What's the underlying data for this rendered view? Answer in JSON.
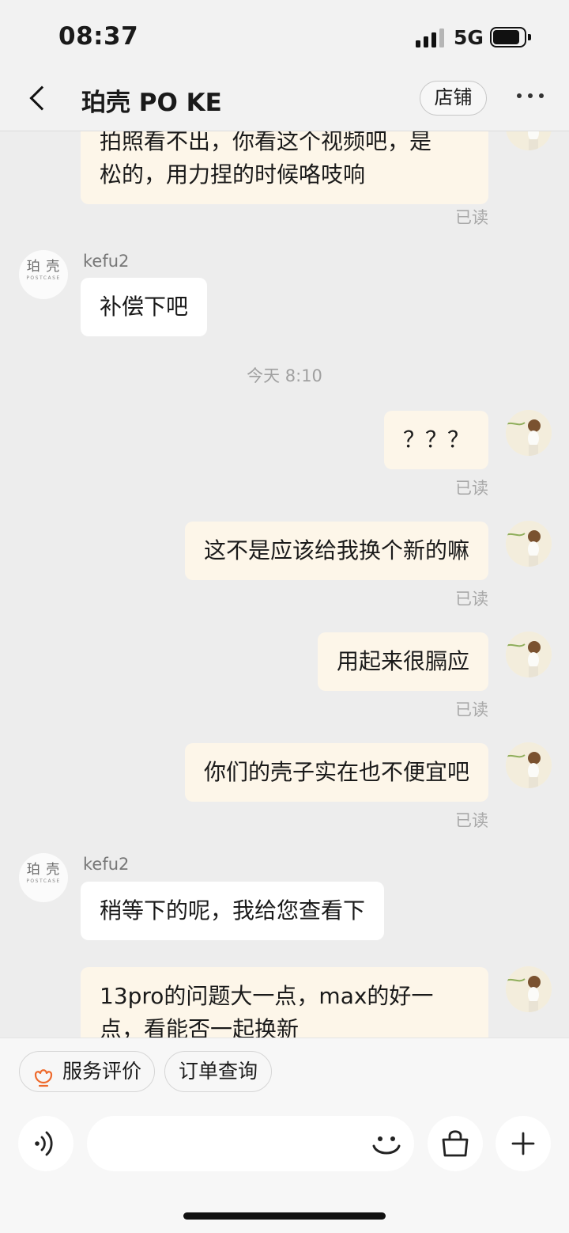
{
  "status_bar": {
    "time": "08:37",
    "network": "5G"
  },
  "header": {
    "title": "珀壳 PO KE",
    "store_label": "店铺"
  },
  "shop_avatar": {
    "logo_text": "珀 壳",
    "logo_sub": "POSTCASE"
  },
  "messages": [
    {
      "from": "me",
      "lines": [
        "拍照看不出，你看这个视频吧，是",
        "松的，用力捏的时候咯吱响"
      ],
      "status": "已读"
    },
    {
      "from": "shop",
      "sender": "kefu2",
      "text": "补偿下吧"
    },
    {
      "timestamp": "今天 8:10"
    },
    {
      "from": "me",
      "text": "？？？",
      "status": "已读"
    },
    {
      "from": "me",
      "text": "这不是应该给我换个新的嘛",
      "status": "已读"
    },
    {
      "from": "me",
      "text": "用起来很膈应",
      "status": "已读"
    },
    {
      "from": "me",
      "text": "你们的壳子实在也不便宜吧",
      "status": "已读"
    },
    {
      "from": "shop",
      "sender": "kefu2",
      "text": "稍等下的呢，我给您查看下"
    },
    {
      "from": "me",
      "lines": [
        "13pro的问题大一点，max的好一",
        "点，看能否一起换新"
      ]
    }
  ],
  "quick_actions": {
    "service_review": "服务评价",
    "order_query": "订单查询"
  },
  "input_bar": {
    "placeholder": ""
  },
  "colors": {
    "background": "#ededed",
    "my_bubble": "#fdf6e9",
    "shop_bubble": "#ffffff",
    "accent": "#ee6a2c",
    "read_text": "#a8a8a8"
  },
  "icons": [
    "back-icon",
    "more-icon",
    "voice-icon",
    "emoji-icon",
    "shopping-bag-icon",
    "plus-icon",
    "flower-icon"
  ]
}
